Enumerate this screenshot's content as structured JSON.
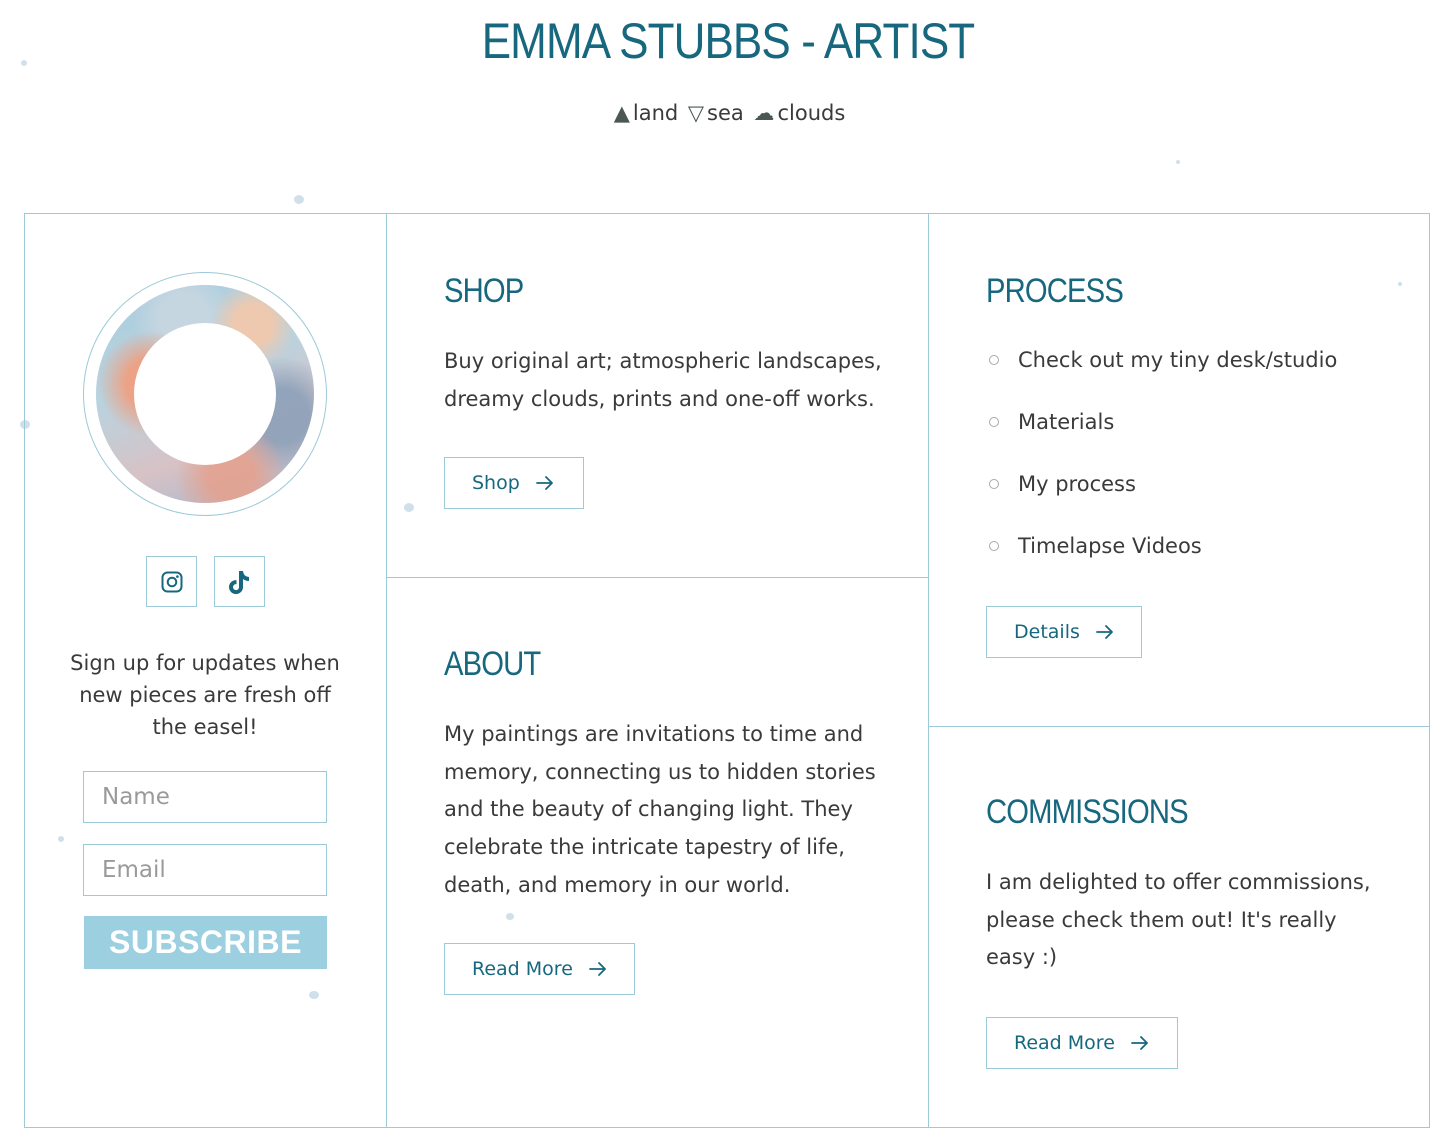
{
  "header": {
    "title": "EMMA STUBBS - ARTIST",
    "tagline": {
      "land_glyph": "▲",
      "land": "land",
      "sea_glyph": "▽",
      "sea": "sea",
      "clouds_glyph": "☁",
      "clouds": "clouds"
    }
  },
  "sidebar": {
    "avatar_alt": "clouds-ring",
    "social": [
      {
        "name": "instagram-icon"
      },
      {
        "name": "tiktok-icon"
      }
    ],
    "signup_text": "Sign up for updates when new pieces are fresh off the easel!",
    "name_placeholder": "Name",
    "email_placeholder": "Email",
    "subscribe_label": "SUBSCRIBE"
  },
  "shop": {
    "heading": "SHOP",
    "text": "Buy original art; atmospheric landscapes, dreamy clouds, prints and one-off works.",
    "button": "Shop"
  },
  "about": {
    "heading": "ABOUT",
    "text": "My paintings are invitations to time and memory, connecting us to hidden stories and the beauty of changing light. They celebrate the intricate tapestry of life, death, and memory in our world.",
    "button": "Read More"
  },
  "process": {
    "heading": "PROCESS",
    "items": [
      "Check out my tiny desk/studio",
      "Materials",
      "My process",
      "Timelapse Videos"
    ],
    "button": "Details"
  },
  "commissions": {
    "heading": "COMMISSIONS",
    "text": "I am delighted to offer commissions, please check them out! It's really easy :)",
    "button": "Read More"
  },
  "colors": {
    "accent": "#17687e",
    "border": "#9ccad8",
    "subscribe_bg": "#9ccfe0",
    "text": "#3a3a3a"
  }
}
